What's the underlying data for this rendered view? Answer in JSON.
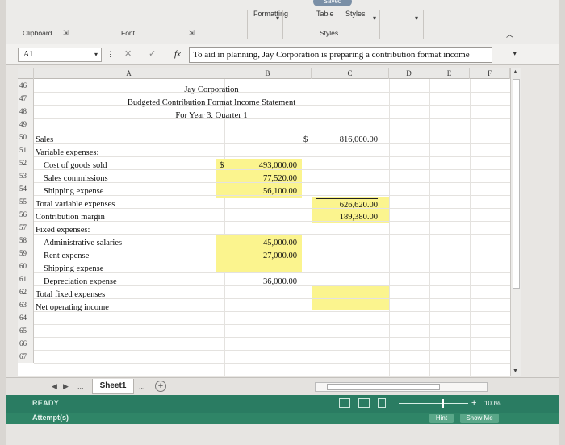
{
  "ribbon": {
    "saved_label": "Saved",
    "top_labels": [
      "Formatting",
      "Table",
      "Styles"
    ],
    "groups": [
      "Clipboard",
      "Font",
      "Styles"
    ]
  },
  "formula_bar": {
    "name_box": "A1",
    "fx_label": "fx",
    "content": "To aid in planning, Jay Corporation is preparing a contribution format income"
  },
  "columns": [
    "A",
    "B",
    "C",
    "D",
    "E",
    "F"
  ],
  "rows": [
    "46",
    "47",
    "48",
    "49",
    "50",
    "51",
    "52",
    "53",
    "54",
    "55",
    "56",
    "57",
    "58",
    "59",
    "60",
    "61",
    "62",
    "63",
    "64",
    "65",
    "66",
    "67"
  ],
  "sheet": {
    "company": "Jay Corporation",
    "title": "Budgeted Contribution Format Income Statement",
    "period": "For Year 3, Quarter 1",
    "lines": {
      "sales": {
        "label": "Sales",
        "dollar": "$",
        "value": "816,000.00"
      },
      "variable_expenses": {
        "label": "Variable expenses:"
      },
      "cogs": {
        "label": "Cost of goods sold",
        "dollar": "$",
        "value": "493,000.00"
      },
      "sales_commissions": {
        "label": "Sales commissions",
        "value": "77,520.00"
      },
      "shipping_var": {
        "label": "Shipping expense",
        "value": "56,100.00"
      },
      "total_variable": {
        "label": "Total variable expenses",
        "value": "626,620.00"
      },
      "contribution_margin": {
        "label": "Contribution margin",
        "value": "189,380.00"
      },
      "fixed_expenses": {
        "label": "Fixed expenses:"
      },
      "admin_salaries": {
        "label": "Administrative salaries",
        "value": "45,000.00"
      },
      "rent": {
        "label": "Rent expense",
        "value": "27,000.00"
      },
      "shipping_fixed": {
        "label": "Shipping expense",
        "value": ""
      },
      "depreciation": {
        "label": "Depreciation expense",
        "value": "36,000.00"
      },
      "total_fixed": {
        "label": "Total fixed expenses",
        "value": ""
      },
      "net_operating_income": {
        "label": "Net operating income",
        "value": ""
      }
    }
  },
  "tabs": {
    "ellipsis": "...",
    "active": "Sheet1",
    "ellipsis_after": "..."
  },
  "status": {
    "mode": "READY",
    "zoom": "100%"
  },
  "assignment": {
    "attempt_label": "Attempt(s)",
    "hint": "Hint",
    "show_me": "Show Me"
  },
  "colors": {
    "highlight": "#fbf48e",
    "status_bar": "#2a7c62"
  }
}
